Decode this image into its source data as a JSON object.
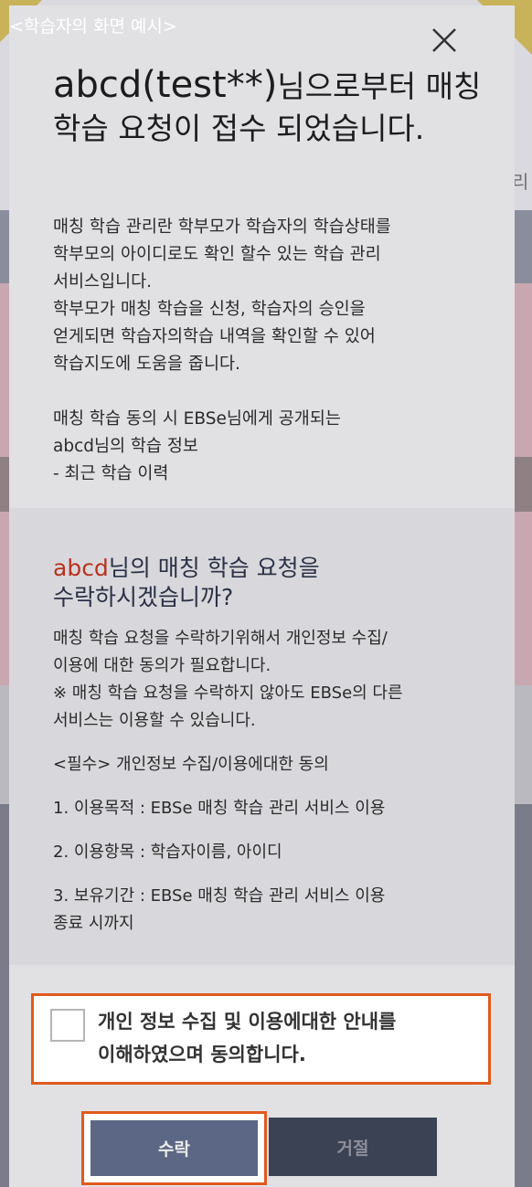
{
  "caption": "<학습자의 화면 예시>",
  "background_peek": "리",
  "modal": {
    "title_user": "abcd(test**)",
    "title_rest": "님으로부터 매칭 학습 요청이 접수 되었습니다.",
    "description": {
      "para1": "매칭 학습 관리란 학부모가 학습자의 학습상태를\n학부모의 아이디로도 확인 할수 있는 학습 관리\n서비스입니다.\n학부모가 매칭 학습을 신청, 학습자의 승인을\n얻게되면 학습자의학습 내역을 확인할 수 있어\n학습지도에 도움을 줍니다.",
      "para2": "매칭 학습 동의 시 EBSe님에게 공개되는\nabcd님의 학습 정보\n- 최근 학습 이력"
    },
    "consent": {
      "title_highlight": "abcd",
      "title_rest": "님의 매칭 학습 요청을",
      "title_line2": "수락하시겠습니까?",
      "body_line1": "매칭 학습 요청을 수락하기위해서 개인정보 수집/",
      "body_line2": "이용에 대한 동의가 필요합니다.",
      "body_line3": "※ 매칭 학습 요청을 수락하지 않아도 EBSe의 다른",
      "body_line4": "서비스는 이용할 수 있습니다.",
      "required_header": "<필수> 개인정보 수집/이용에대한 동의",
      "item1": "1. 이용목적 : EBSe 매칭 학습 관리 서비스 이용",
      "item2": "2. 이용항목 : 학습자이름, 아이디",
      "item3_line1": "3. 보유기간 : EBSe 매칭 학습 관리 서비스 이용",
      "item3_line2": "종료 시까지"
    },
    "agree": {
      "checked": false,
      "label_line1": "개인 정보 수집 및 이용에대한 안내를",
      "label_line2": "이해하였으며 동의합니다."
    },
    "buttons": {
      "accept": "수락",
      "reject": "거절"
    }
  },
  "colors": {
    "highlight_border": "#e05a1c",
    "accept_bg": "#5b6784",
    "reject_bg": "#3b4254",
    "highlight_text": "#b8321f"
  }
}
